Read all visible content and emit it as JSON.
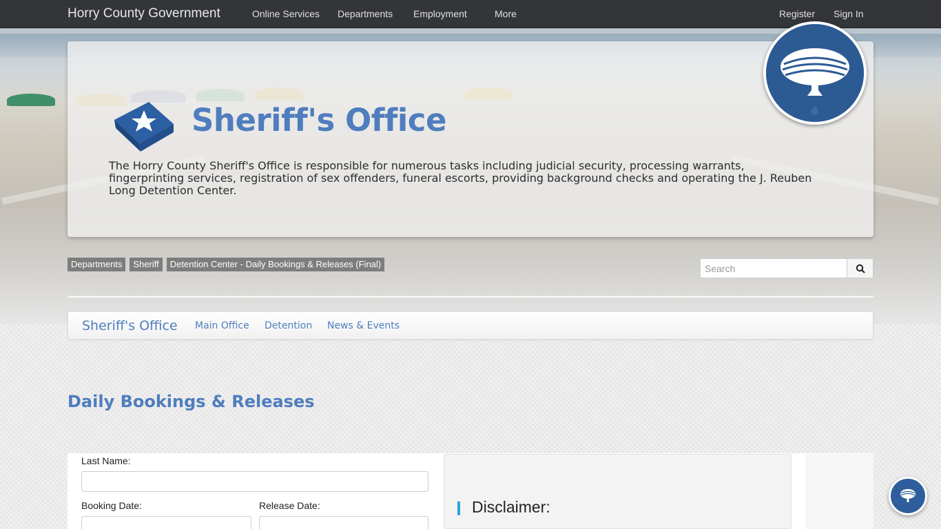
{
  "topnav": {
    "brand": "Horry County Government",
    "links": [
      "Online Services",
      "Departments",
      "Employment",
      "More"
    ],
    "register": "Register",
    "signin": "Sign In"
  },
  "header": {
    "title": "Sheriff's Office",
    "description": "The Horry County Sheriff's Office is responsible for numerous tasks including judicial security, processing warrants, fingerprinting services, registration of sex offenders, funeral escorts, providing background checks and operating the J. Reuben Long Detention Center."
  },
  "breadcrumb": [
    "Departments",
    "Sheriff",
    "Detention Center - Daily Bookings & Releases (Final)"
  ],
  "search": {
    "placeholder": "Search"
  },
  "subnav": {
    "title": "Sheriff's Office",
    "links": [
      "Main Office",
      "Detention",
      "News & Events"
    ]
  },
  "page": {
    "heading": "Daily Bookings & Releases"
  },
  "form": {
    "last_name_label": "Last Name:",
    "booking_date_label": "Booking Date:",
    "release_date_label": "Release Date:"
  },
  "disclaimer": {
    "title": "Disclaimer:"
  },
  "colors": {
    "accent": "#4f7dbe",
    "navbar": "#333538",
    "logo": "#2c5a93",
    "disclaimer_bar": "#2aa6d8"
  }
}
